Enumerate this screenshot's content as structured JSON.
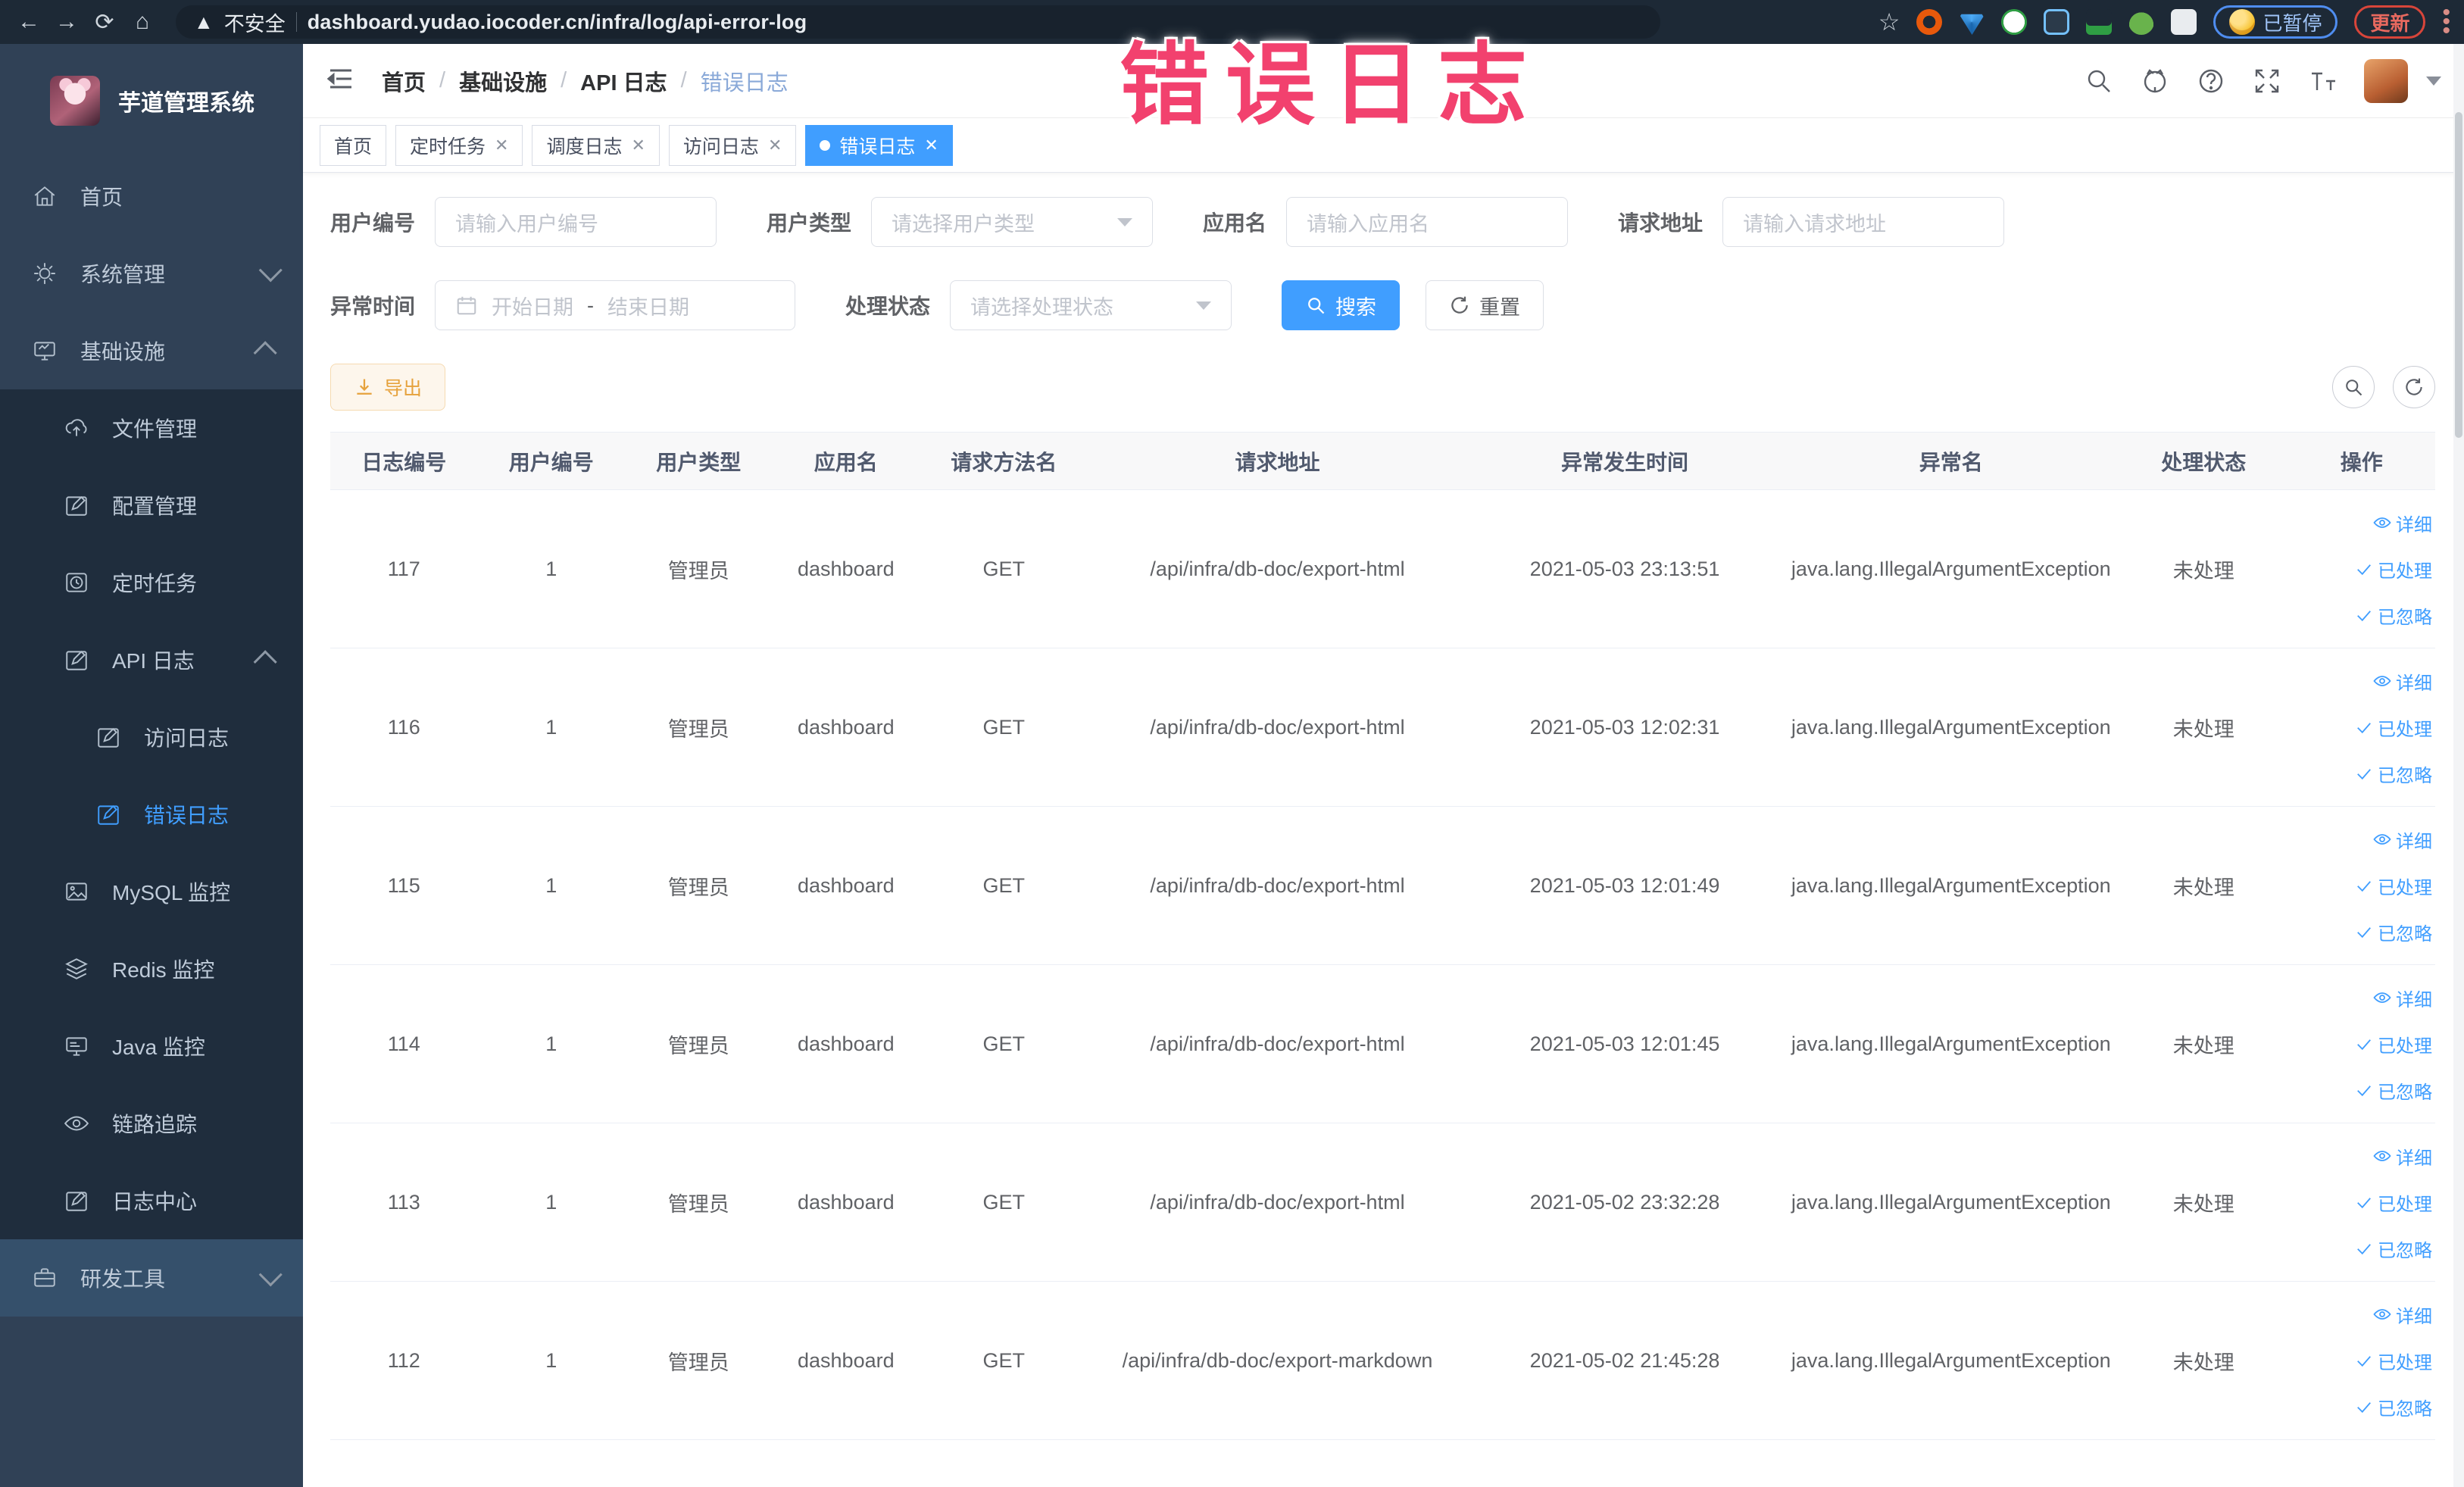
{
  "browser": {
    "security_label": "不安全",
    "url": "dashboard.yudao.iocoder.cn/infra/log/api-error-log",
    "paused_label": "已暂停",
    "update_label": "更新"
  },
  "annotation": {
    "text": "错误日志",
    "color": "#f2416e"
  },
  "sidebar": {
    "logo_title": "芋道管理系统",
    "items": [
      {
        "label": "首页"
      },
      {
        "label": "系统管理"
      },
      {
        "label": "基础设施"
      },
      {
        "label": "文件管理"
      },
      {
        "label": "配置管理"
      },
      {
        "label": "定时任务"
      },
      {
        "label": "API 日志"
      },
      {
        "label": "访问日志"
      },
      {
        "label": "错误日志"
      },
      {
        "label": "MySQL 监控"
      },
      {
        "label": "Redis 监控"
      },
      {
        "label": "Java 监控"
      },
      {
        "label": "链路追踪"
      },
      {
        "label": "日志中心"
      },
      {
        "label": "研发工具"
      }
    ]
  },
  "breadcrumb": {
    "items": [
      "首页",
      "基础设施",
      "API 日志",
      "错误日志"
    ]
  },
  "tabs": [
    {
      "label": "首页"
    },
    {
      "label": "定时任务"
    },
    {
      "label": "调度日志"
    },
    {
      "label": "访问日志"
    },
    {
      "label": "错误日志"
    }
  ],
  "filters": {
    "user_id_label": "用户编号",
    "user_id_placeholder": "请输入用户编号",
    "user_type_label": "用户类型",
    "user_type_placeholder": "请选择用户类型",
    "app_name_label": "应用名",
    "app_name_placeholder": "请输入应用名",
    "request_url_label": "请求地址",
    "request_url_placeholder": "请输入请求地址",
    "exception_time_label": "异常时间",
    "start_date_placeholder": "开始日期",
    "range_separator": "-",
    "end_date_placeholder": "结束日期",
    "process_status_label": "处理状态",
    "process_status_placeholder": "请选择处理状态",
    "search_label": "搜索",
    "reset_label": "重置"
  },
  "toolbar": {
    "export_label": "导出"
  },
  "table": {
    "headers": [
      "日志编号",
      "用户编号",
      "用户类型",
      "应用名",
      "请求方法名",
      "请求地址",
      "异常发生时间",
      "异常名",
      "处理状态",
      "操作"
    ],
    "actions": {
      "detail": "详细",
      "processed": "已处理",
      "ignored": "已忽略"
    },
    "rows": [
      {
        "id": "117",
        "user_id": "1",
        "user_type": "管理员",
        "app_name": "dashboard",
        "method": "GET",
        "url": "/api/infra/db-doc/export-html",
        "time": "2021-05-03 23:13:51",
        "exception": "java.lang.IllegalArgumentException",
        "status": "未处理"
      },
      {
        "id": "116",
        "user_id": "1",
        "user_type": "管理员",
        "app_name": "dashboard",
        "method": "GET",
        "url": "/api/infra/db-doc/export-html",
        "time": "2021-05-03 12:02:31",
        "exception": "java.lang.IllegalArgumentException",
        "status": "未处理"
      },
      {
        "id": "115",
        "user_id": "1",
        "user_type": "管理员",
        "app_name": "dashboard",
        "method": "GET",
        "url": "/api/infra/db-doc/export-html",
        "time": "2021-05-03 12:01:49",
        "exception": "java.lang.IllegalArgumentException",
        "status": "未处理"
      },
      {
        "id": "114",
        "user_id": "1",
        "user_type": "管理员",
        "app_name": "dashboard",
        "method": "GET",
        "url": "/api/infra/db-doc/export-html",
        "time": "2021-05-03 12:01:45",
        "exception": "java.lang.IllegalArgumentException",
        "status": "未处理"
      },
      {
        "id": "113",
        "user_id": "1",
        "user_type": "管理员",
        "app_name": "dashboard",
        "method": "GET",
        "url": "/api/infra/db-doc/export-html",
        "time": "2021-05-02 23:32:28",
        "exception": "java.lang.IllegalArgumentException",
        "status": "未处理"
      },
      {
        "id": "112",
        "user_id": "1",
        "user_type": "管理员",
        "app_name": "dashboard",
        "method": "GET",
        "url": "/api/infra/db-doc/export-markdown",
        "time": "2021-05-02 21:45:28",
        "exception": "java.lang.IllegalArgumentException",
        "status": "未处理"
      }
    ]
  }
}
